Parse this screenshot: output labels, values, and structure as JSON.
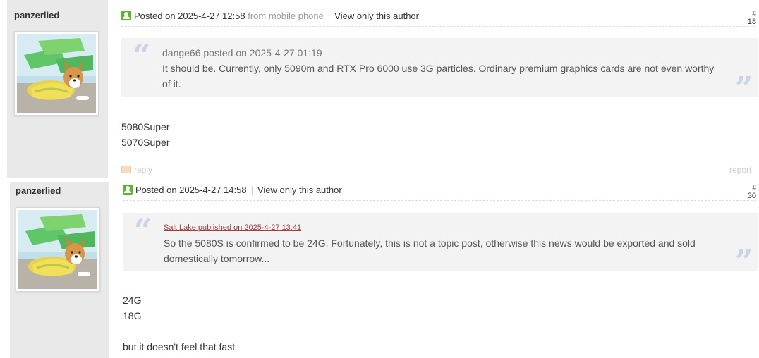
{
  "posts": [
    {
      "author": "panzerlied",
      "posted_label": "Posted on 2025-4-27 12:58",
      "source": "from mobile phone",
      "separator": "|",
      "view_author": "View only this author",
      "floor_hash": "#",
      "floor": "18",
      "quote": {
        "author_line": "dange66 posted on 2025-4-27 01:19",
        "text": "It should be. Currently, only 5090m and RTX Pro 6000 use 3G particles. Ordinary premium graphics cards are not even worthy of it."
      },
      "body_lines": [
        "5080Super",
        "5070Super"
      ],
      "reply_label": "reply",
      "report_label": "report"
    },
    {
      "author": "panzerlied",
      "posted_label": "Posted on 2025-4-27 14:58",
      "separator": "|",
      "view_author": "View only this author",
      "floor_hash": "#",
      "floor": "30",
      "quote": {
        "author_line": "Salt Lake published on 2025-4-27 13:41",
        "text": "So the 5080S is confirmed to be 24G. Fortunately, this is not a topic post, otherwise this news would be exported and sold domestically tomorrow..."
      },
      "body_lines": [
        "24G",
        "18G",
        "",
        "but it doesn't feel that fast"
      ]
    }
  ],
  "quote_marks": {
    "open": "“",
    "close": "”"
  },
  "colors": {
    "sidebar_bg": "#e9e9e9",
    "quote_bg": "#f3f3f3",
    "quote_mark": "#c9d6e3",
    "post_icon": "#5cb531"
  },
  "icons": {
    "post_status": "user-icon",
    "reply": "reply-icon",
    "avatar": "corgi-avatar-image"
  }
}
